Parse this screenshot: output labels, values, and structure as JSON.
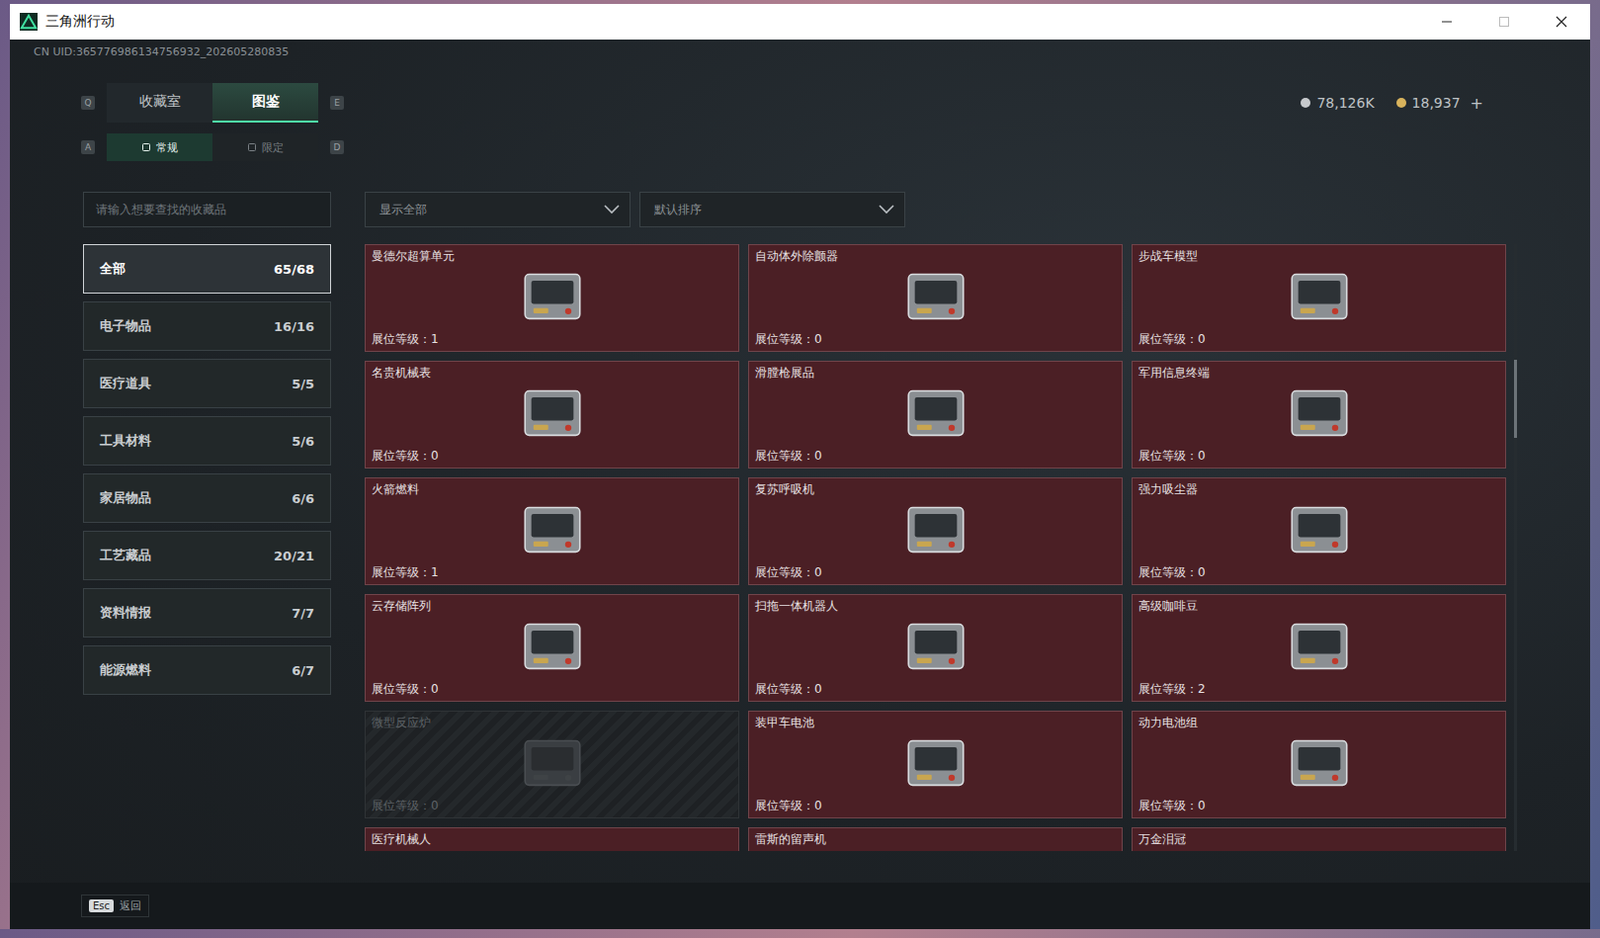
{
  "window": {
    "title": "三角洲行动"
  },
  "uid": "CN UID:365776986134756932_202605280835",
  "currencies": [
    {
      "amount": "78,126K",
      "color": "#c7cacd"
    },
    {
      "amount": "18,937",
      "color": "#d8b35c"
    }
  ],
  "add_button": "+",
  "main_tabs": {
    "prev_key": "Q",
    "next_key": "E",
    "items": [
      {
        "label": "收藏室",
        "selected": false
      },
      {
        "label": "图鉴",
        "selected": true
      }
    ]
  },
  "sub_tabs": {
    "prev_key": "A",
    "next_key": "D",
    "items": [
      {
        "label": "常规",
        "selected": true
      },
      {
        "label": "限定",
        "selected": false
      }
    ]
  },
  "search": {
    "placeholder": "请输入想要查找的收藏品"
  },
  "filters": [
    {
      "value": "显示全部"
    },
    {
      "value": "默认排序"
    }
  ],
  "sidebar": {
    "items": [
      {
        "label": "全部",
        "count": "65/68",
        "selected": true
      },
      {
        "label": "电子物品",
        "count": "16/16",
        "selected": false
      },
      {
        "label": "医疗道具",
        "count": "5/5",
        "selected": false
      },
      {
        "label": "工具材料",
        "count": "5/6",
        "selected": false
      },
      {
        "label": "家居物品",
        "count": "6/6",
        "selected": false
      },
      {
        "label": "工艺藏品",
        "count": "20/21",
        "selected": false
      },
      {
        "label": "资料情报",
        "count": "7/7",
        "selected": false
      },
      {
        "label": "能源燃料",
        "count": "6/7",
        "selected": false
      }
    ]
  },
  "grid": {
    "level_label": "展位等级：",
    "items": [
      {
        "name": "曼德尔超算单元",
        "level": "1",
        "collected": true
      },
      {
        "name": "自动体外除颤器",
        "level": "0",
        "collected": true
      },
      {
        "name": "步战车模型",
        "level": "0",
        "collected": true
      },
      {
        "name": "名贵机械表",
        "level": "0",
        "collected": true
      },
      {
        "name": "滑膛枪展品",
        "level": "0",
        "collected": true
      },
      {
        "name": "军用信息终端",
        "level": "0",
        "collected": true
      },
      {
        "name": "火箭燃料",
        "level": "1",
        "collected": true
      },
      {
        "name": "复苏呼吸机",
        "level": "0",
        "collected": true
      },
      {
        "name": "强力吸尘器",
        "level": "0",
        "collected": true
      },
      {
        "name": "云存储阵列",
        "level": "0",
        "collected": true
      },
      {
        "name": "扫拖一体机器人",
        "level": "0",
        "collected": true
      },
      {
        "name": "高级咖啡豆",
        "level": "2",
        "collected": true
      },
      {
        "name": "微型反应炉",
        "level": "0",
        "collected": false
      },
      {
        "name": "装甲车电池",
        "level": "0",
        "collected": true
      },
      {
        "name": "动力电池组",
        "level": "0",
        "collected": true
      },
      {
        "name": "医疗机械人",
        "collected": true
      },
      {
        "name": "雷斯的留声机",
        "collected": true
      },
      {
        "name": "万金泪冠",
        "collected": true
      }
    ]
  },
  "scrollbar": {
    "offset": 0.19,
    "size": 0.13
  },
  "footer": {
    "key": "Esc",
    "label": "返回"
  }
}
